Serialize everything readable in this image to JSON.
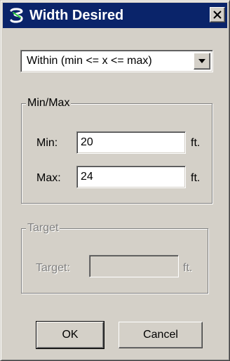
{
  "window": {
    "title": "Width Desired",
    "close_glyph": "×",
    "title_bar_color": "#0a246a",
    "app_icon": "app-logo-icon"
  },
  "mode_select": {
    "value": "Within (min <= x <= max)",
    "arrow_icon": "chevron-down-icon"
  },
  "minmax_group": {
    "legend": "Min/Max",
    "min_label": "Min:",
    "min_value": "20",
    "min_unit": "ft.",
    "max_label": "Max:",
    "max_value": "24",
    "max_unit": "ft."
  },
  "target_group": {
    "legend": "Target",
    "target_label": "Target:",
    "target_value": "",
    "target_unit": "ft.",
    "enabled": false
  },
  "buttons": {
    "ok_label": "OK",
    "cancel_label": "Cancel"
  }
}
